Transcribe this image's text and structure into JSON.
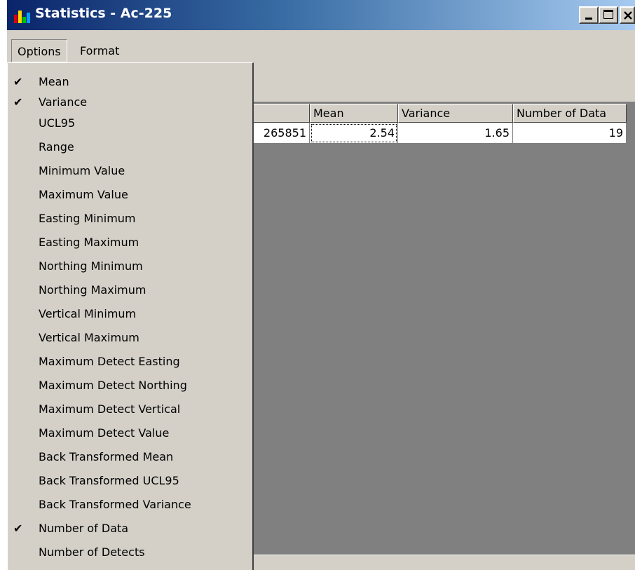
{
  "window": {
    "title": "Statistics - Ac-225",
    "icon": "statistics-chart-icon",
    "controls": {
      "minimize_icon": "minimize-icon",
      "maximize_icon": "maximize-icon",
      "close_icon": "close-icon"
    }
  },
  "menubar": {
    "items": [
      {
        "label": "Options",
        "open": true
      },
      {
        "label": "Format",
        "open": false
      }
    ]
  },
  "options_menu": {
    "items": [
      {
        "label": "Mean",
        "checked": true
      },
      {
        "label": "Variance",
        "checked": true
      },
      {
        "label": "UCL95",
        "checked": false
      },
      {
        "label": "Range",
        "checked": false
      },
      {
        "label": "Minimum Value",
        "checked": false
      },
      {
        "label": "Maximum Value",
        "checked": false
      },
      {
        "label": "Easting Minimum",
        "checked": false
      },
      {
        "label": "Easting Maximum",
        "checked": false
      },
      {
        "label": "Northing Minimum",
        "checked": false
      },
      {
        "label": "Northing Maximum",
        "checked": false
      },
      {
        "label": "Vertical Minimum",
        "checked": false
      },
      {
        "label": "Vertical Maximum",
        "checked": false
      },
      {
        "label": "Maximum Detect Easting",
        "checked": false
      },
      {
        "label": "Maximum Detect Northing",
        "checked": false
      },
      {
        "label": "Maximum Detect Vertical",
        "checked": false
      },
      {
        "label": "Maximum Detect Value",
        "checked": false
      },
      {
        "label": "Back Transformed Mean",
        "checked": false
      },
      {
        "label": "Back Transformed UCL95",
        "checked": false
      },
      {
        "label": "Back Transformed Variance",
        "checked": false
      },
      {
        "label": "Number of Data",
        "checked": true
      },
      {
        "label": "Number of Detects",
        "checked": false
      }
    ],
    "check_glyph": "✔"
  },
  "grid": {
    "columns": [
      "",
      "Mean",
      "Variance",
      "Number of Data"
    ],
    "rows": [
      [
        "265851",
        "2.54",
        "1.65",
        "19"
      ]
    ]
  }
}
